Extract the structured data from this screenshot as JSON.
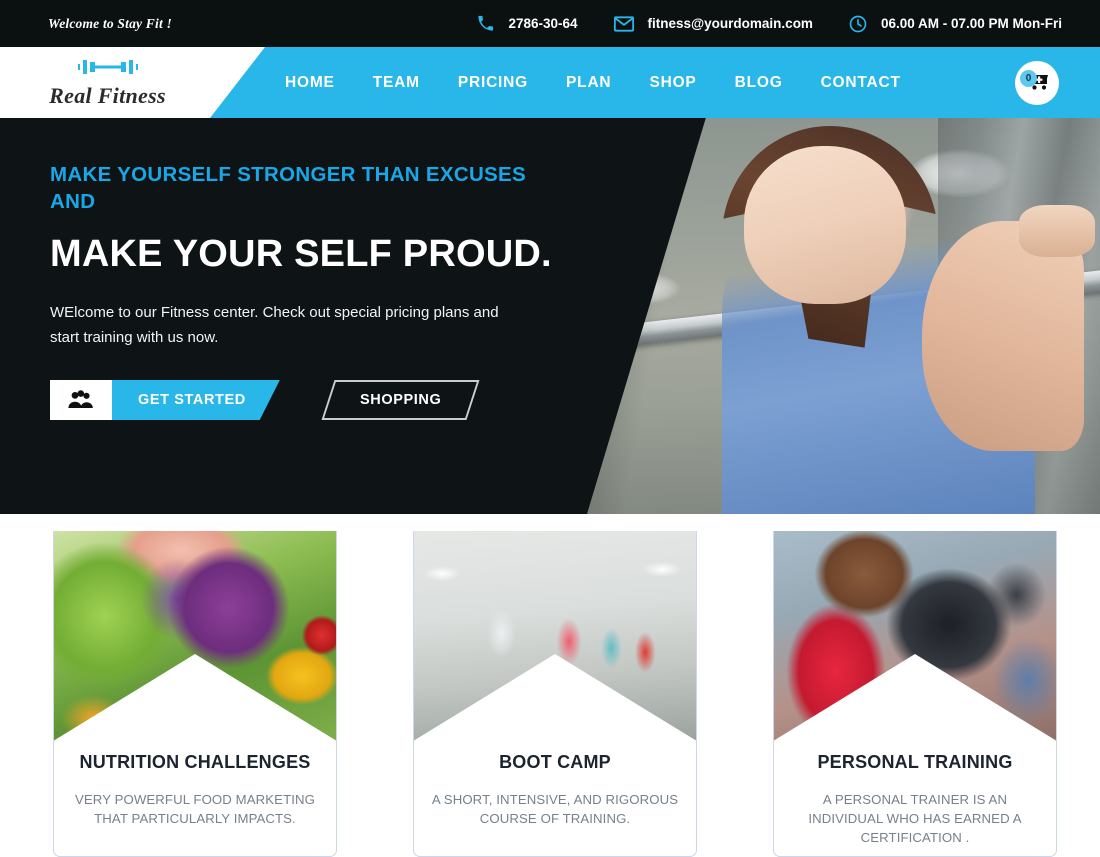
{
  "topbar": {
    "welcome": "Welcome to Stay Fit !",
    "phone": "2786-30-64",
    "email": "fitness@yourdomain.com",
    "hours": "06.00 AM - 07.00 PM  Mon-Fri",
    "phone_icon": "phone-icon",
    "email_icon": "envelope-icon",
    "clock_icon": "clock-icon",
    "background": "#0b1011",
    "icon_color": "#29b6e8"
  },
  "header": {
    "brand": "Real Fitness",
    "brand_icon": "dumbbell-icon",
    "nav": [
      {
        "label": "HOME"
      },
      {
        "label": "TEAM"
      },
      {
        "label": "PRICING"
      },
      {
        "label": "PLAN"
      },
      {
        "label": "SHOP"
      },
      {
        "label": "BLOG"
      },
      {
        "label": "CONTACT"
      }
    ],
    "cart": {
      "icon": "shopping-cart-icon",
      "count": "0"
    },
    "accent": "#29b6e8"
  },
  "hero": {
    "kicker": "MAKE  YOURSELF STRONGER THAN EXCUSES AND",
    "title": "MAKE YOUR SELF PROUD.",
    "subtitle": "WElcome to our Fitness center. Check out special pricing plans and start  training with us now.",
    "primary_button": {
      "label": "GET STARTED",
      "icon": "group-people-icon"
    },
    "secondary_button": {
      "label": "SHOPPING"
    },
    "kicker_color": "#1aa7e8",
    "background": "#0e1315",
    "image_alt": "woman doing barbell squat in gym"
  },
  "cards": [
    {
      "title": "NUTRITION CHALLENGES",
      "desc": "VERY POWERFUL FOOD MARKETING THAT PARTICULARLY IMPACTS.",
      "image_alt": "fresh vegetables lettuce kale peppers"
    },
    {
      "title": "BOOT CAMP",
      "desc": "A SHORT, INTENSIVE, AND RIGOROUS COURSE OF TRAINING.",
      "image_alt": "group fitness class jumping in studio"
    },
    {
      "title": "PERSONAL TRAINING",
      "desc": "A PERSONAL TRAINER IS AN INDIVIDUAL WHO HAS EARNED A CERTIFICATION .",
      "image_alt": "bodybuilder lifting dumbbell"
    }
  ]
}
